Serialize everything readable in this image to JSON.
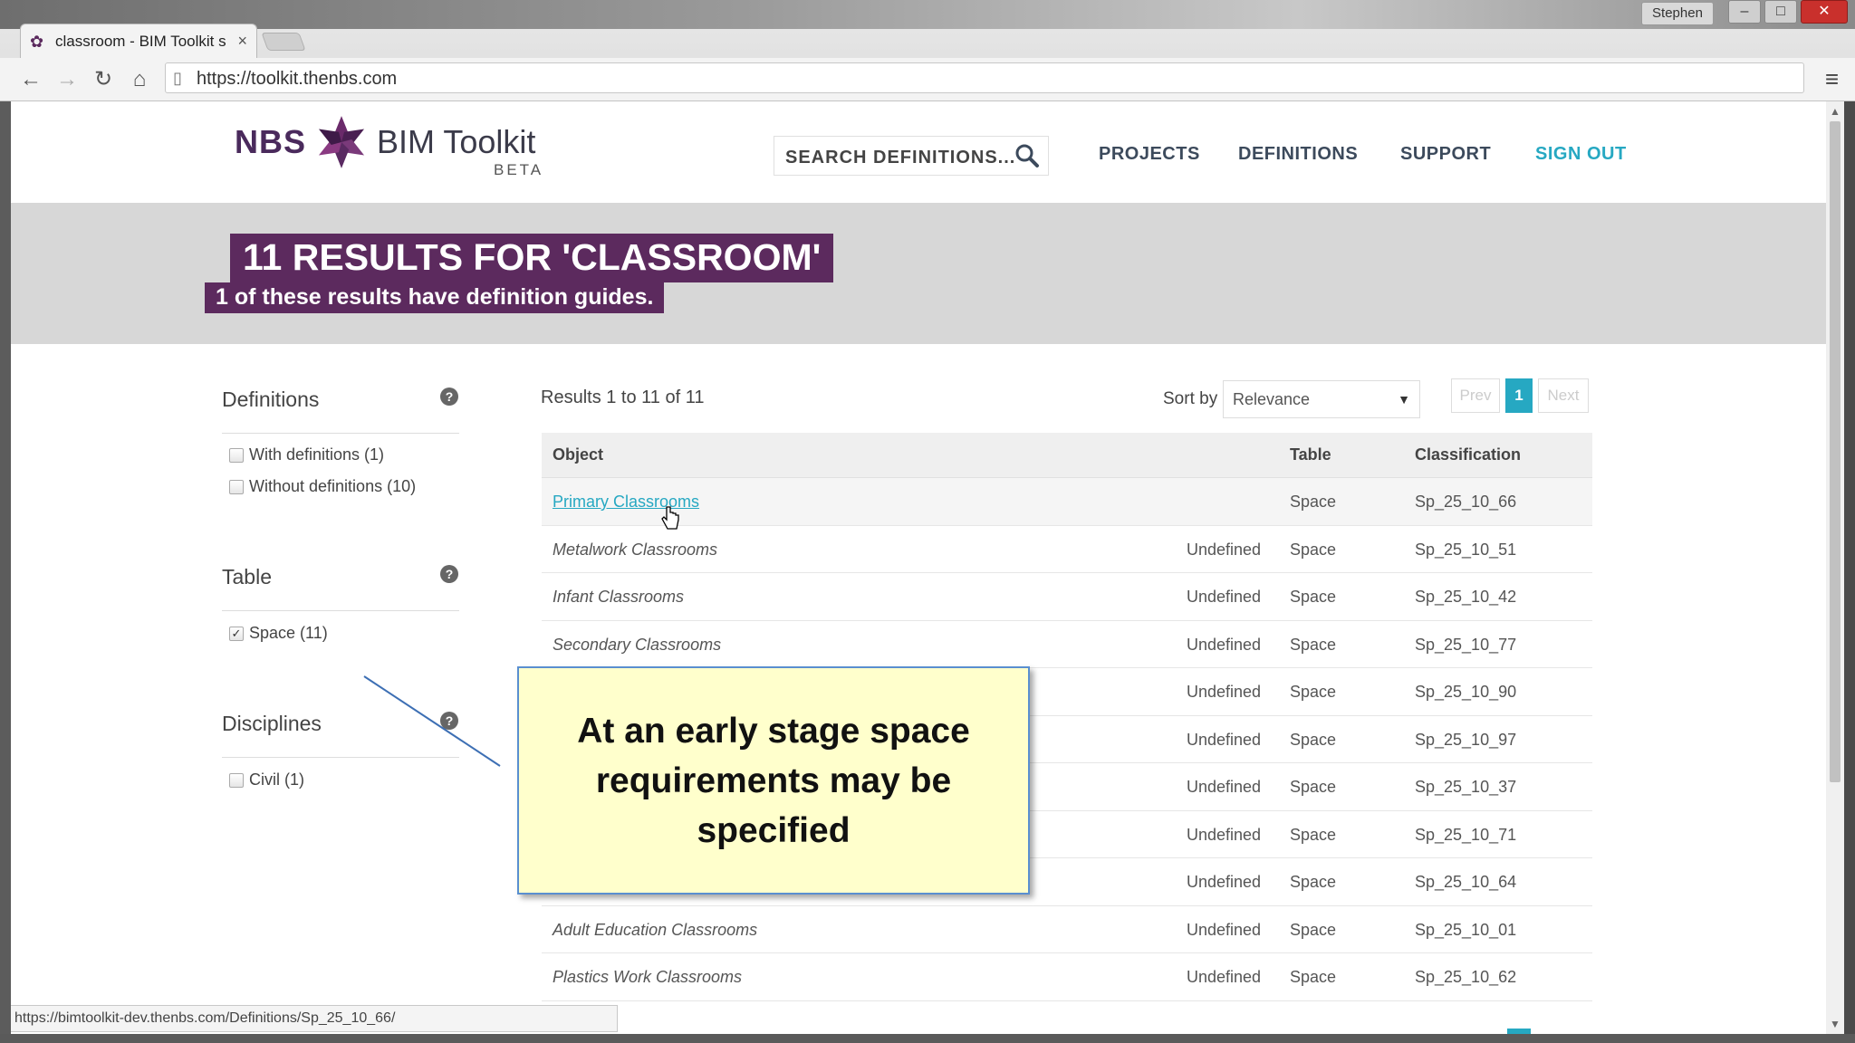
{
  "browser": {
    "tab_title": "classroom - BIM Toolkit s",
    "tab_close": "×",
    "url": "https://toolkit.thenbs.com",
    "user": "Stephen",
    "status_url": "https://bimtoolkit-dev.thenbs.com/Definitions/Sp_25_10_66/"
  },
  "header": {
    "logo_nbs": "NBS",
    "logo_product": "BIM Toolkit",
    "logo_beta": "BETA",
    "search_placeholder": "SEARCH DEFINITIONS...",
    "nav": {
      "projects": "PROJECTS",
      "definitions": "DEFINITIONS",
      "support": "SUPPORT",
      "signout": "SIGN OUT"
    }
  },
  "banner": {
    "title": "11 RESULTS FOR 'CLASSROOM'",
    "subtitle": "1 of these results have definition guides."
  },
  "facets": {
    "definitions": {
      "title": "Definitions",
      "options": [
        {
          "label": "With definitions (1)",
          "checked": false
        },
        {
          "label": "Without definitions (10)",
          "checked": false
        }
      ]
    },
    "table": {
      "title": "Table",
      "options": [
        {
          "label": "Space (11)",
          "checked": true
        }
      ]
    },
    "disciplines": {
      "title": "Disciplines",
      "options": [
        {
          "label": "Civil (1)",
          "checked": false
        }
      ]
    }
  },
  "results": {
    "count_text": "Results 1 to 11 of 11",
    "sort_label": "Sort by",
    "sort_value": "Relevance",
    "pagination": {
      "prev": "Prev",
      "current": "1",
      "next": "Next"
    },
    "columns": {
      "object": "Object",
      "table": "Table",
      "classification": "Classification"
    },
    "rows": [
      {
        "object": "Primary Classrooms",
        "guide": "",
        "table": "Space",
        "classification": "Sp_25_10_66"
      },
      {
        "object": "Metalwork Classrooms",
        "guide": "Undefined",
        "table": "Space",
        "classification": "Sp_25_10_51"
      },
      {
        "object": "Infant Classrooms",
        "guide": "Undefined",
        "table": "Space",
        "classification": "Sp_25_10_42"
      },
      {
        "object": "Secondary Classrooms",
        "guide": "Undefined",
        "table": "Space",
        "classification": "Sp_25_10_77"
      },
      {
        "object": "",
        "guide": "Undefined",
        "table": "Space",
        "classification": "Sp_25_10_90"
      },
      {
        "object": "",
        "guide": "Undefined",
        "table": "Space",
        "classification": "Sp_25_10_97"
      },
      {
        "object": "",
        "guide": "Undefined",
        "table": "Space",
        "classification": "Sp_25_10_37"
      },
      {
        "object": "",
        "guide": "Undefined",
        "table": "Space",
        "classification": "Sp_25_10_71"
      },
      {
        "object": "",
        "guide": "Undefined",
        "table": "Space",
        "classification": "Sp_25_10_64"
      },
      {
        "object": "Adult Education Classrooms",
        "guide": "Undefined",
        "table": "Space",
        "classification": "Sp_25_10_01"
      },
      {
        "object": "Plastics Work Classrooms",
        "guide": "Undefined",
        "table": "Space",
        "classification": "Sp_25_10_62"
      }
    ]
  },
  "callout": {
    "text": "At an early stage space requirements may be specified"
  },
  "colors": {
    "brand_purple": "#5c2a5e",
    "accent_teal": "#26a8c2",
    "callout_bg": "#ffffcc"
  }
}
